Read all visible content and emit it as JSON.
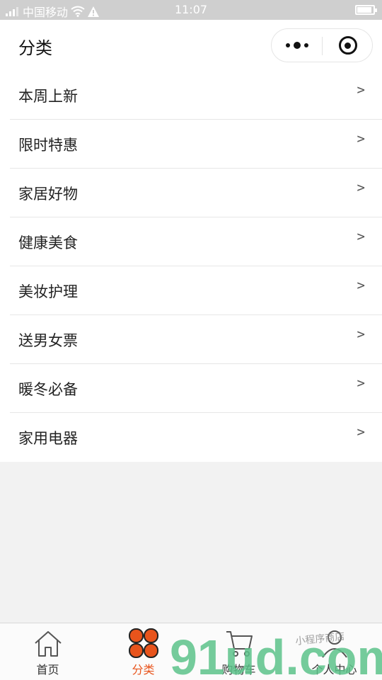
{
  "status_bar": {
    "carrier": "中国移动",
    "time": "11:07"
  },
  "nav": {
    "title": "分类",
    "more_icon": "more-dots-icon",
    "close_icon": "target-circle-icon"
  },
  "categories": [
    {
      "label": "本周上新",
      "chevron": ">"
    },
    {
      "label": "限时特惠",
      "chevron": ">"
    },
    {
      "label": "家居好物",
      "chevron": ">"
    },
    {
      "label": "健康美食",
      "chevron": ">"
    },
    {
      "label": "美妆护理",
      "chevron": ">"
    },
    {
      "label": "送男女票",
      "chevron": ">"
    },
    {
      "label": "暖冬必备",
      "chevron": ">"
    },
    {
      "label": "家用电器",
      "chevron": ">"
    }
  ],
  "tabs": [
    {
      "label": "首页",
      "icon": "home-icon"
    },
    {
      "label": "分类",
      "icon": "category-icon",
      "active": true
    },
    {
      "label": "购物车",
      "icon": "cart-icon"
    },
    {
      "label": "个人中心",
      "icon": "user-icon"
    }
  ],
  "watermark": {
    "logo": "91ud.com",
    "handwriting": "小程序商店"
  },
  "colors": {
    "accent": "#e8541c",
    "watermark_green": "#5cc28a",
    "background": "#f2f2f2"
  }
}
